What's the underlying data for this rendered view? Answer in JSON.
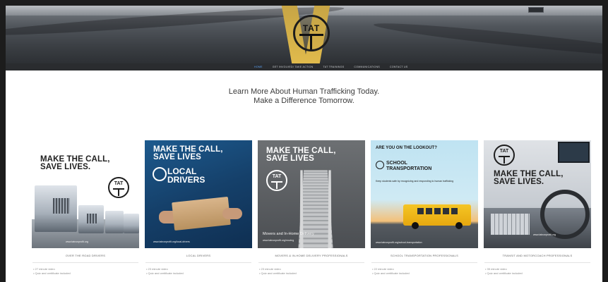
{
  "header": {
    "logo_text": "TAT",
    "nav": [
      {
        "label": "HOME",
        "active": true
      },
      {
        "label": "GET INVOLVED/ TAKE ACTION",
        "active": false
      },
      {
        "label": "TAT TRAININGS",
        "active": false
      },
      {
        "label": "COMMUNICATIONS",
        "active": false
      },
      {
        "label": "CONTACT US",
        "active": false
      }
    ]
  },
  "headline": {
    "line1": "Learn More About Human Trafficking Today.",
    "line2": "Make a Difference Tomorrow."
  },
  "cards": [
    {
      "poster_line1": "MAKE THE CALL,",
      "poster_line2": "SAVE LIVES.",
      "poster_url": "www.tatnonprofit.org",
      "caption": "OVER THE ROAD DRIVERS",
      "bullets": [
        "27 minute video",
        "Quiz and certificate included"
      ]
    },
    {
      "poster_line1": "MAKE THE CALL,",
      "poster_line2": "SAVE LIVES",
      "poster_sub1": "LOCAL",
      "poster_sub2": "DRIVERS",
      "poster_url": "www.tatnonprofit.org/local-drivers",
      "caption": "LOCAL DRIVERS",
      "bullets": [
        "23 minute video",
        "Quiz and certificate included"
      ]
    },
    {
      "poster_line1": "MAKE THE CALL,",
      "poster_line2": "SAVE LIVES",
      "poster_sub1": "Movers and In-Home Delivery",
      "poster_url": "www.tatnonprofit.org/moving",
      "caption": "MOVERS & IN-HOME DELIVERY PROFESSIONALS",
      "bullets": [
        "23 minute video",
        "Quiz and certificate included"
      ]
    },
    {
      "poster_line1": "ARE YOU ON THE LOOKOUT?",
      "poster_sub1": "SCHOOL",
      "poster_sub2": "TRANSPORTATION",
      "poster_body": "Keep students safe by recognizing and responding to human trafficking",
      "poster_url": "www.tatnonprofit.org/school-transportation",
      "caption": "SCHOOL TRANSPORTATION PROFESSIONALS",
      "bullets": [
        "22 minute video",
        "Quiz and certificate included"
      ]
    },
    {
      "poster_line1": "MAKE THE CALL,",
      "poster_line2": "SAVE LIVES.",
      "poster_url": "www.tatnonprofit.org",
      "caption": "TRANSIT AND MOTORCOACH PROFESSIONALS",
      "bullets": [
        "35 minute video",
        "Quiz and certificate included"
      ]
    }
  ],
  "colors": {
    "nav_active": "#5ea8ff",
    "nav_bg": "#2a2c2f",
    "road_line": "#e0ba4c",
    "local_blue": "#15406a",
    "bus_yellow": "#f5c524"
  }
}
